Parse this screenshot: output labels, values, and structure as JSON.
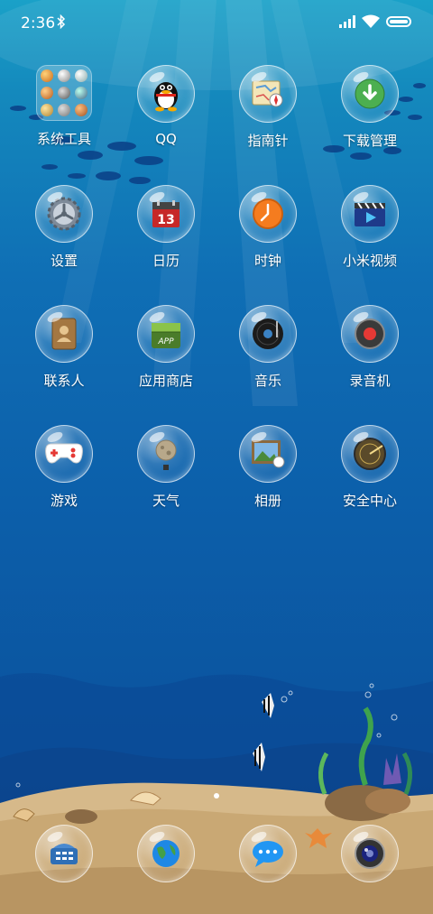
{
  "status_bar": {
    "time": "2:36",
    "icons": [
      "bluetooth-icon",
      "signal-icon",
      "wifi-icon",
      "battery-icon"
    ]
  },
  "apps": [
    {
      "label": "系统工具",
      "icon": "folder-icon"
    },
    {
      "label": "QQ",
      "icon": "qq-penguin-icon"
    },
    {
      "label": "指南针",
      "icon": "compass-icon"
    },
    {
      "label": "下载管理",
      "icon": "download-icon"
    },
    {
      "label": "设置",
      "icon": "gear-icon"
    },
    {
      "label": "日历",
      "icon": "calendar-icon",
      "badge": "13"
    },
    {
      "label": "时钟",
      "icon": "clock-icon"
    },
    {
      "label": "小米视频",
      "icon": "clapperboard-icon"
    },
    {
      "label": "联系人",
      "icon": "contacts-book-icon"
    },
    {
      "label": "应用商店",
      "icon": "app-store-icon",
      "badge": "APP"
    },
    {
      "label": "音乐",
      "icon": "music-disc-icon"
    },
    {
      "label": "录音机",
      "icon": "recorder-icon"
    },
    {
      "label": "游戏",
      "icon": "gamepad-icon"
    },
    {
      "label": "天气",
      "icon": "weather-moon-icon"
    },
    {
      "label": "相册",
      "icon": "photo-album-icon"
    },
    {
      "label": "安全中心",
      "icon": "radar-icon"
    }
  ],
  "dock": [
    {
      "icon": "phone-icon"
    },
    {
      "icon": "browser-globe-icon"
    },
    {
      "icon": "messages-icon"
    },
    {
      "icon": "camera-icon"
    }
  ],
  "page_indicator": {
    "pages": 1,
    "current": 1
  },
  "colors": {
    "ocean_top": "#1aa1c8",
    "ocean_bottom": "#0a4e97",
    "sand": "#d6b98a"
  }
}
